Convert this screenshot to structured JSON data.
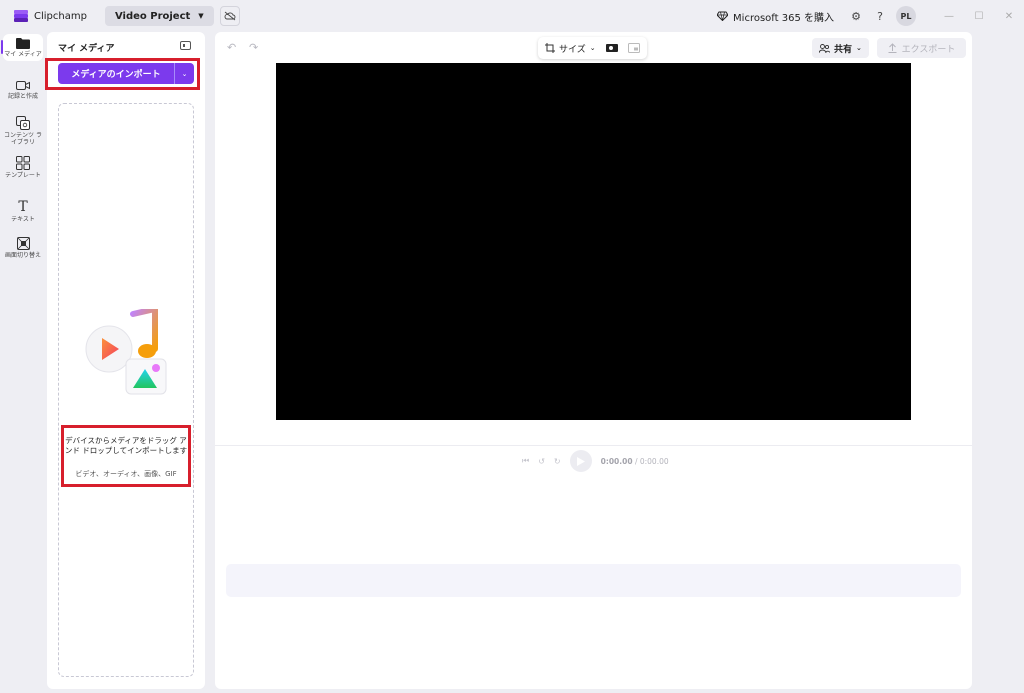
{
  "titlebar": {
    "app_name": "Clipchamp",
    "project_name": "Video Project",
    "m365_label": "Microsoft 365 を購入",
    "avatar_initials": "PL"
  },
  "rail": {
    "items": [
      {
        "label": "マイ メディア",
        "icon": "folder-icon"
      },
      {
        "label": "記録と作成",
        "icon": "video-camera-icon"
      },
      {
        "label": "コンテンツ ライブラリ",
        "icon": "library-icon"
      },
      {
        "label": "テンプレート",
        "icon": "templates-icon"
      },
      {
        "label": "テキスト",
        "icon": "text-icon"
      },
      {
        "label": "画面切り替え",
        "icon": "transitions-icon"
      }
    ]
  },
  "media_panel": {
    "title": "マイ メディア",
    "import_label": "メディアのインポート",
    "drop_text": "デバイスからメディアをドラッグ アンド ドロップしてインポートします",
    "drop_subtext": "ビデオ、オーディオ、画像、GIF"
  },
  "editor": {
    "size_label": "サイズ",
    "share_label": "共有",
    "export_label": "エクスポート",
    "time_current": "0:00.00",
    "time_total": "/ 0:00.00"
  },
  "colors": {
    "accent": "#7c3aed",
    "highlight": "#d71f2c"
  }
}
